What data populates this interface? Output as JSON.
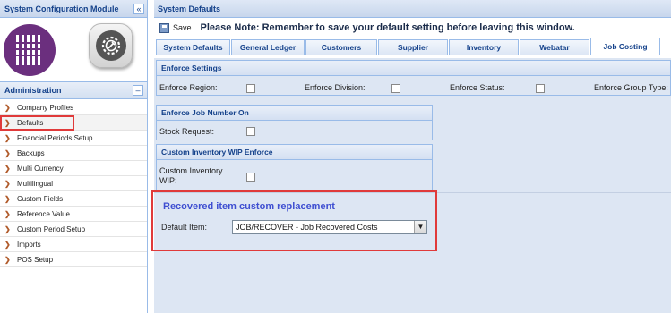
{
  "left_panel": {
    "title": "System Configuration Module",
    "collapse": "«",
    "admin_title": "Administration",
    "admin_collapse": "–",
    "menu_items": [
      {
        "label": "Company Profiles",
        "selected": false
      },
      {
        "label": "Defaults",
        "selected": true
      },
      {
        "label": "Financial Periods Setup",
        "selected": false
      },
      {
        "label": "Backups",
        "selected": false
      },
      {
        "label": "Multi Currency",
        "selected": false
      },
      {
        "label": "Multilingual",
        "selected": false
      },
      {
        "label": "Custom Fields",
        "selected": false
      },
      {
        "label": "Reference Value",
        "selected": false
      },
      {
        "label": "Custom Period Setup",
        "selected": false
      },
      {
        "label": "Imports",
        "selected": false
      },
      {
        "label": "POS Setup",
        "selected": false
      }
    ]
  },
  "right_panel": {
    "title": "System Defaults",
    "save_label": "Save",
    "note": "Please Note: Remember to save your default setting before leaving this window.",
    "tabs": [
      {
        "label": "System Defaults"
      },
      {
        "label": "General Ledger"
      },
      {
        "label": "Customers"
      },
      {
        "label": "Supplier"
      },
      {
        "label": "Inventory"
      },
      {
        "label": "Webatar"
      },
      {
        "label": "Job Costing",
        "active": true
      }
    ],
    "enforce_settings": {
      "title": "Enforce Settings",
      "region": "Enforce Region:",
      "division": "Enforce Division:",
      "status": "Enforce Status:",
      "group_type": "Enforce Group Type:"
    },
    "enforce_job_number": {
      "title": "Enforce Job Number On",
      "stock_request": "Stock Request:"
    },
    "custom_inventory": {
      "title": "Custom Inventory WIP Enforce",
      "label_line1": "Custom Inventory",
      "label_line2": "WIP:"
    },
    "recovered": {
      "title": "Recovered item custom replacement",
      "default_item_label": "Default Item:",
      "default_item_value": "JOB/RECOVER - Job Recovered Costs"
    }
  },
  "colors": {
    "accent": "#15428b",
    "highlight_red": "#e03a3a",
    "recovered_title": "#3f4fd1",
    "logo_purple": "#6b2f7e"
  }
}
